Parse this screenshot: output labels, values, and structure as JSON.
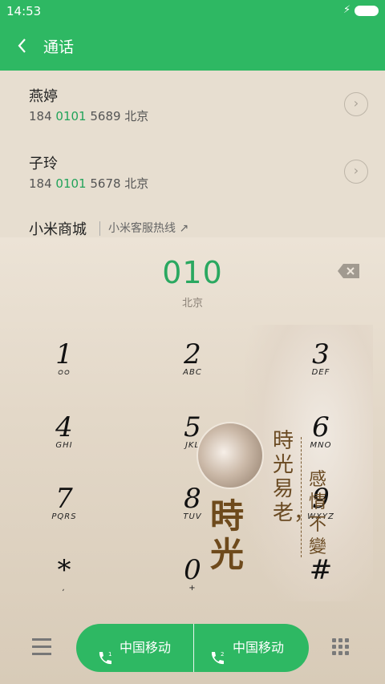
{
  "status": {
    "time": "14:53",
    "charging_icon": "lightning-icon",
    "battery_icon": "battery-icon"
  },
  "header": {
    "back_icon": "chevron-left-icon",
    "title": "通话"
  },
  "contacts": [
    {
      "name": "燕婷",
      "prefix": "184 ",
      "match": "0101",
      "rest": " 5689  北京"
    },
    {
      "name": "子玲",
      "prefix": "184 ",
      "match": "0101",
      "rest": " 5678  北京"
    },
    {
      "name": "小米商城",
      "hotline": "小米客服热线 ↗"
    }
  ],
  "dial": {
    "number": "010",
    "location": "北京"
  },
  "keys": [
    {
      "digit": "1",
      "letters": "ᴑᴑ"
    },
    {
      "digit": "2",
      "letters": "ABC"
    },
    {
      "digit": "3",
      "letters": "DEF"
    },
    {
      "digit": "4",
      "letters": "GHI"
    },
    {
      "digit": "5",
      "letters": "JKL"
    },
    {
      "digit": "6",
      "letters": "MNO"
    },
    {
      "digit": "7",
      "letters": "PQRS"
    },
    {
      "digit": "8",
      "letters": "TUV"
    },
    {
      "digit": "9",
      "letters": "WXYZ"
    },
    {
      "digit": "*",
      "letters": ","
    },
    {
      "digit": "0",
      "letters": "+"
    },
    {
      "digit": "#",
      "letters": ""
    }
  ],
  "art": {
    "big": "時光",
    "col1": "時光易老，",
    "col2": "感情不變"
  },
  "bottom": {
    "sim1_label": "中国移动",
    "sim2_label": "中国移动",
    "sim1_badge": "1",
    "sim2_badge": "2"
  },
  "colors": {
    "accent": "#2eb863",
    "match": "#22a35a"
  }
}
